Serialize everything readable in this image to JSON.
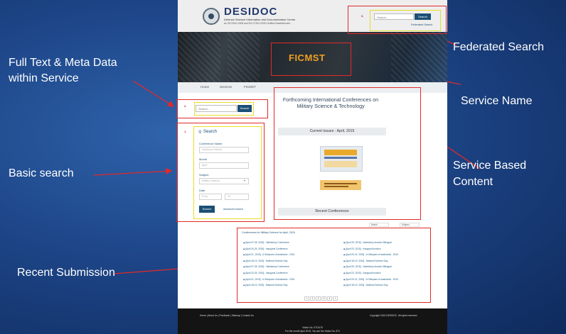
{
  "callouts": {
    "federated": "Federated Search",
    "fulltext_line1": "Full Text & Meta Data",
    "fulltext_line2": "within Service",
    "service_name": "Service Name",
    "basic": "Basic search",
    "service_content_line1": "Service Based",
    "service_content_line2": "Content",
    "recent": "Recent Submission"
  },
  "markers": {
    "m1": "1.",
    "m2": "2.",
    "m3": "3."
  },
  "site": {
    "logo_title": "DESIDOC",
    "logo_sub": "Defence Science Information and Documentation Centre",
    "logo_sub2": "An ISO 9001:2008 and ISO 27001:2005 Certified Establishment",
    "header_search": {
      "placeholder": "Search...",
      "button": "Search",
      "federated_link": "Federated Search"
    },
    "banner_title": "FICMST",
    "breadcrumb": [
      "Home",
      "Services",
      "FICMST"
    ],
    "service_search": {
      "placeholder": "Search...",
      "button": "Search"
    },
    "basic": {
      "title": "Search",
      "conf_label": "Conference Name",
      "conf_placeholder": "Vedchron Fairline",
      "month_label": "Month",
      "month_placeholder": "April",
      "subject_label": "Subject",
      "subject_placeholder": "Military Science",
      "date_label": "Date",
      "from_placeholder": "From",
      "to_placeholder": "To",
      "button": "Search",
      "advanced_link": "Advanced search"
    },
    "content": {
      "title": "Forthcoming International Conferences on Military Science & Technology",
      "current_issues": "Current Issues - April, 2015",
      "recent_conferences": "Recent Conferences",
      "sort_month": "Month",
      "sort_subject": "Subject"
    },
    "recent": {
      "heading": "Conferences for Military Science for April, 2015",
      "left": [
        "[April 27-28, 2015] : Valedictory Conference",
        "[April 24-25, 2015] : Inaugural Conference",
        "[April 21, 2015] : A Glimpses of landmarks - 2015",
        "[April 18-19, 2015] : National Science Day",
        "[April 27-28, 2015] : Valedictory Conference",
        "[April 24-25, 2015] : Inaugural Conference",
        "[April 21, 2015] : A Glimpses of landmarks - 2015",
        "[April 18-19, 2015] : National Science Day"
      ],
      "right": [
        "[April 25, 2015] : Valedictory function Bilingual",
        "[April 23, 2015] : Inaugural function",
        "[April 20-21, 2015] : A Glimpses of landmarks - 2015",
        "[April 18-19, 2015] : National Science Day",
        "[April 25, 2015] : Valedictory function Bilingual",
        "[April 23, 2015] : Inaugural function",
        "[April 20-21, 2015] : A Glimpses of landmarks - 2015",
        "[April 18-19, 2015] : National Science Day"
      ],
      "pages": [
        "«",
        "1",
        "2",
        "3",
        "4",
        "»"
      ]
    },
    "footer": {
      "links": "Home | About Us | Feedback | Sitemap | Contact Us",
      "copyright": "Copyright 2015 DESIDOC. All rights reserved.",
      "visitor1": "Visitor No. 0711075",
      "visitor2": "For the month April 2015, You are the Visitor No. 871"
    }
  },
  "colors": {
    "annotation_red": "#e02a2a",
    "annotation_yellow": "#e8dc2a",
    "brand_blue": "#1b4f76",
    "banner_title": "#f0a020"
  }
}
